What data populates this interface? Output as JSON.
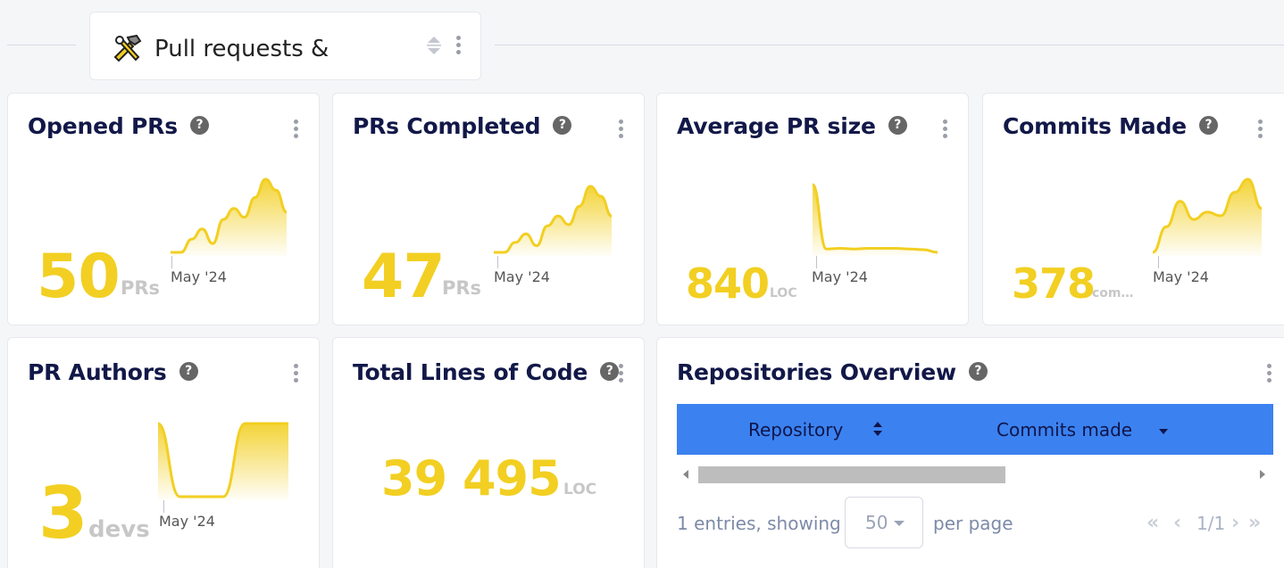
{
  "section": {
    "title": "Pull requests &",
    "icon": "hammer-wrench-icon"
  },
  "cards": {
    "opened_prs": {
      "title": "Opened PRs",
      "value": "50",
      "unit": "PRs",
      "date": "May '24",
      "trend": [
        0,
        0,
        0.18,
        0.32,
        0.12,
        0.45,
        0.6,
        0.48,
        0.75,
        1.0,
        0.85,
        0.55
      ]
    },
    "prs_completed": {
      "title": "PRs Completed",
      "value": "47",
      "unit": "PRs",
      "date": "May '24",
      "trend": [
        0,
        0,
        0.15,
        0.28,
        0.1,
        0.4,
        0.55,
        0.42,
        0.7,
        1.0,
        0.85,
        0.55
      ]
    },
    "avg_pr_size": {
      "title": "Average PR size",
      "value": "840",
      "unit": "LOC",
      "date": "May '24",
      "trend": [
        1.0,
        0.05,
        0.06,
        0.05,
        0.06,
        0.06,
        0.06,
        0.05,
        0.04,
        0.0
      ]
    },
    "commits_made": {
      "title": "Commits Made",
      "value": "378",
      "unit": "com…",
      "date": "May '24",
      "trend": [
        0.0,
        0.35,
        0.7,
        0.45,
        0.55,
        0.5,
        0.82,
        1.0,
        0.6
      ]
    },
    "pr_authors": {
      "title": "PR Authors",
      "value": "3",
      "unit": "devs",
      "date": "May '24",
      "trend": [
        1.0,
        0.0,
        0.0,
        0.0,
        1.0,
        1.0,
        1.0
      ]
    },
    "total_loc": {
      "title": "Total Lines of Code",
      "value": "39 495",
      "unit": "LOC"
    }
  },
  "repos": {
    "title": "Repositories Overview",
    "columns": [
      "Repository",
      "Commits made"
    ],
    "summary": "1 entries, showing",
    "per_page_value": "50",
    "per_page_label": "per page",
    "page_indicator": "1/1"
  },
  "help_glyph": "?",
  "colors": {
    "accent": "#f2cf22",
    "header_blue": "#3b82f0",
    "title": "#121848"
  }
}
